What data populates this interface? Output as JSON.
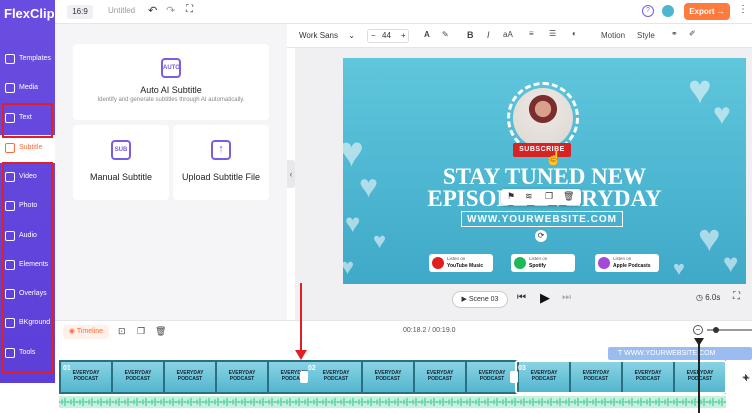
{
  "app": {
    "logo": "FlexClip",
    "ratio": "16:9",
    "title": "Untitled",
    "export": "Export"
  },
  "sidebar": [
    {
      "label": "Templates",
      "icon": "templates-icon"
    },
    {
      "label": "Media",
      "icon": "media-icon"
    },
    {
      "label": "Text",
      "icon": "text-icon"
    },
    {
      "label": "Subtitle",
      "icon": "subtitle-icon"
    },
    {
      "label": "Video",
      "icon": "video-icon"
    },
    {
      "label": "Photo",
      "icon": "photo-icon"
    },
    {
      "label": "Audio",
      "icon": "audio-icon"
    },
    {
      "label": "Elements",
      "icon": "elements-icon"
    },
    {
      "label": "Overlays",
      "icon": "overlays-icon"
    },
    {
      "label": "BKground",
      "icon": "background-icon"
    },
    {
      "label": "Tools",
      "icon": "tools-icon"
    }
  ],
  "panel": {
    "auto": {
      "icon": "AUTO",
      "title": "Auto AI Subtitle",
      "desc": "Identify and generate subtitles through AI automatically."
    },
    "manual": {
      "icon": "SUB",
      "title": "Manual Subtitle"
    },
    "upload": {
      "title": "Upload Subtitle File"
    }
  },
  "toolbar": {
    "font": "Work Sans",
    "size": "44",
    "minus": "−",
    "plus": "+",
    "motion": "Motion",
    "style": "Style"
  },
  "canvas": {
    "subscribe": "SUBSCRIBE",
    "line1": "STAY TUNED NEW",
    "line2": "EPISODE EVERYDAY",
    "url": "WWW.YOURWEBSITE.COM",
    "badges": [
      {
        "top": "Listen on",
        "name": "YouTube Music",
        "color": "#e02020"
      },
      {
        "top": "Listen on",
        "name": "Spotify",
        "color": "#1db954"
      },
      {
        "top": "Listen on",
        "name": "Apple Podcasts",
        "color": "#a24bd8"
      }
    ]
  },
  "player": {
    "scene": "Scene 03",
    "duration": "6.0s"
  },
  "timeline": {
    "label": "Timeline",
    "time": "00:18.2 / 00:19.0",
    "text_clip": "T  WWW.YOURWEBSITE.COM",
    "clip_numbers": [
      "01",
      "02",
      "03"
    ],
    "clip_title": "EVERYDAY PODCAST"
  }
}
